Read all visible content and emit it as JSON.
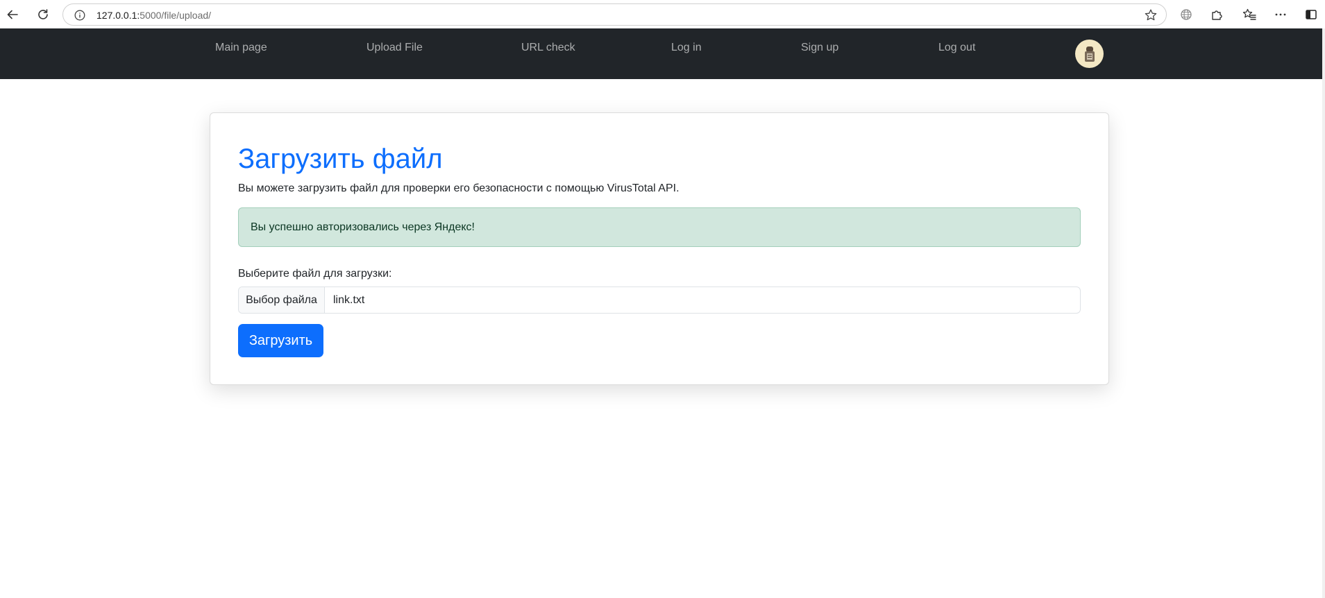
{
  "browser": {
    "url_host": "127.0.0.1:",
    "url_path": "5000/file/upload/",
    "icons": [
      "back-arrow-icon",
      "reload-icon",
      "info-icon",
      "star-icon",
      "globe-icon",
      "extensions-icon",
      "favorites-icon",
      "more-icon",
      "sidebar-icon"
    ]
  },
  "navbar": {
    "links": [
      "Main page",
      "Upload File",
      "URL check",
      "Log in",
      "Sign up",
      "Log out"
    ],
    "background": "#212529",
    "avatar_icon": "user-avatar-icon"
  },
  "card": {
    "title": "Загрузить файл",
    "description": "Вы можете загрузить файл для проверки его безопасности с помощью VirusTotal API.",
    "alert": "Вы успешно авторизовались через Яндекс!",
    "file_label": "Выберите файл для загрузки:",
    "file_button": "Выбор файла",
    "file_name": "link.txt",
    "submit": "Загрузить",
    "accent": "#0d6efd",
    "alert_color": "#d1e7dd"
  }
}
